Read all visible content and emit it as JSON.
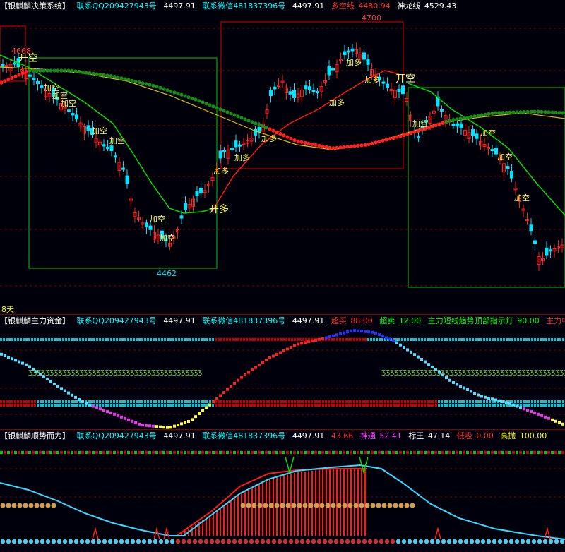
{
  "pane1": {
    "title": "【银麒麟决策系统】",
    "qq": "联系QQ209427943号",
    "qq_val": "4497.91",
    "wx": "联系微信481837396号",
    "wx_val": "4497.91",
    "duokong_label": "多空线",
    "duokong_val": "4480.94",
    "shenlong_label": "神龙线",
    "shenlong_val": "4529.43",
    "high_label": "4700",
    "left_high_label": "4668",
    "low_label": "4462",
    "days_label": "8天",
    "signals": {
      "kaikong": "开空",
      "kaiduo": "开多",
      "jiakong": "加空",
      "jiaduo": "加多"
    }
  },
  "pane2": {
    "title": "【银麒麟主力资金】",
    "qq": "联系QQ209427943号",
    "qq_val": "4497.91",
    "wx": "联系微信481837396号",
    "wx_val": "4497.91",
    "chaomai_label": "超买",
    "chaomai_val": "88.00",
    "chaomai2_label": "超卖",
    "chaomai2_val": "12.00",
    "short_label": "主力短线趋势顶部指示灯",
    "short_val": "90.00",
    "long_label": "主力中长线趋势"
  },
  "pane3": {
    "title": "【银麒麟顺势而为】",
    "qq": "联系QQ209427943号",
    "qq_val": "4497.91",
    "wx": "联系微信481837396号",
    "wx_val": "4497.91",
    "v1": "43.66",
    "shentong_label": "神通",
    "shentong_val": "52.41",
    "biaowang_label": "标王",
    "biaowang_val": "47.14",
    "dixi_label": "低吸",
    "dixi_val": "0.00",
    "gaopao_label": "高抛",
    "gaopao_val": "100.00"
  },
  "colors": {
    "up": "#ff2020",
    "down": "#00e5ff",
    "ma_green": "#00e000",
    "ma_red": "#ff1818",
    "ma_yellow": "#e0c000",
    "box_green": "#00cc00",
    "box_red": "#e00000"
  }
}
